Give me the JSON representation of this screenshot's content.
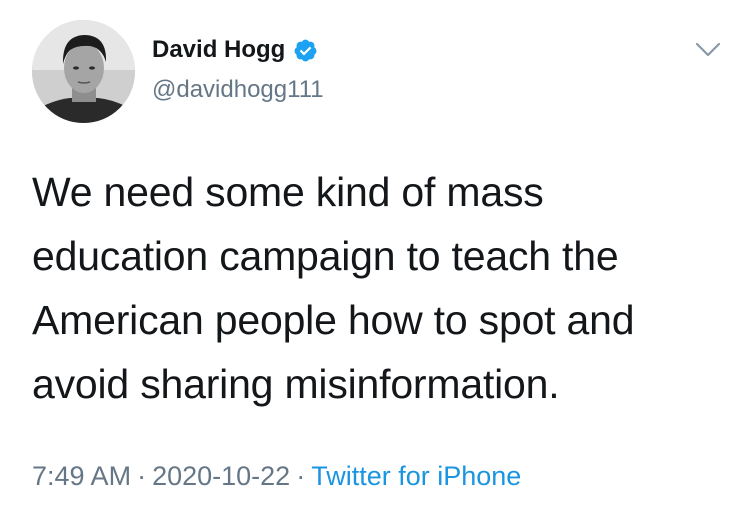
{
  "author": {
    "display_name": "David Hogg",
    "handle": "@davidhogg111",
    "verified_icon": "verified-badge-icon",
    "avatar_icon": "profile-photo"
  },
  "menu": {
    "caret_icon": "chevron-down-icon"
  },
  "tweet": {
    "lines": [
      "We need some kind of mass",
      "education campaign to teach the",
      "American people how to spot and",
      "avoid sharing misinformation."
    ]
  },
  "meta": {
    "time": "7:49 AM",
    "separator": "·",
    "date": "2020-10-22",
    "source": "Twitter for iPhone"
  },
  "colors": {
    "text": "#14171a",
    "secondary": "#657786",
    "link": "#1b95e0",
    "verified": "#1da1f2"
  }
}
